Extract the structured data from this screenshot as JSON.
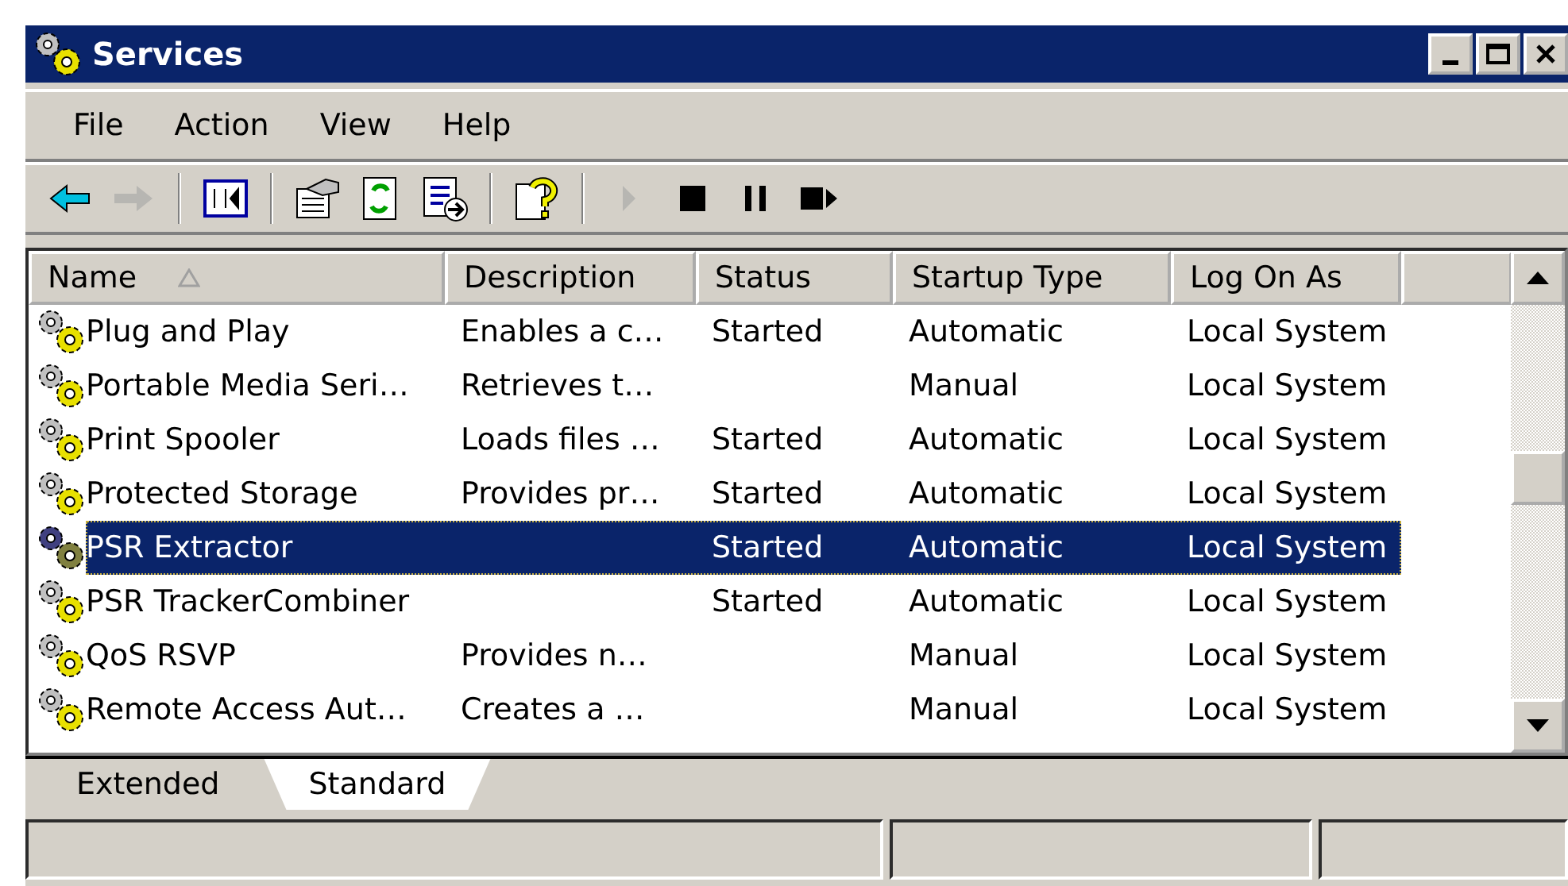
{
  "window": {
    "title": "Services"
  },
  "menu": [
    {
      "label": "File"
    },
    {
      "label": "Action"
    },
    {
      "label": "View"
    },
    {
      "label": "Help"
    }
  ],
  "toolbar": [
    {
      "kind": "back",
      "disabled": false
    },
    {
      "kind": "forward",
      "disabled": true
    },
    {
      "kind": "sep"
    },
    {
      "kind": "tree",
      "disabled": false
    },
    {
      "kind": "sep"
    },
    {
      "kind": "properties",
      "disabled": false
    },
    {
      "kind": "refresh",
      "disabled": false
    },
    {
      "kind": "export",
      "disabled": false
    },
    {
      "kind": "sep"
    },
    {
      "kind": "help",
      "disabled": false
    },
    {
      "kind": "sep"
    },
    {
      "kind": "start",
      "disabled": true
    },
    {
      "kind": "stop",
      "disabled": false
    },
    {
      "kind": "pause",
      "disabled": false
    },
    {
      "kind": "restart",
      "disabled": false
    }
  ],
  "table": {
    "columns": [
      "Name",
      "Description",
      "Status",
      "Startup Type",
      "Log On As"
    ],
    "rows": [
      {
        "name": "Plug and Play",
        "description": "Enables a c…",
        "status": "Started",
        "startup_type": "Automatic",
        "log_on_as": "Local System",
        "selected": false
      },
      {
        "name": "Portable Media Seri…",
        "description": "Retrieves t…",
        "status": "",
        "startup_type": "Manual",
        "log_on_as": "Local System",
        "selected": false
      },
      {
        "name": "Print Spooler",
        "description": "Loads files …",
        "status": "Started",
        "startup_type": "Automatic",
        "log_on_as": "Local System",
        "selected": false
      },
      {
        "name": "Protected Storage",
        "description": "Provides pr…",
        "status": "Started",
        "startup_type": "Automatic",
        "log_on_as": "Local System",
        "selected": false
      },
      {
        "name": "PSR Extractor",
        "description": "",
        "status": "Started",
        "startup_type": "Automatic",
        "log_on_as": "Local System",
        "selected": true
      },
      {
        "name": "PSR TrackerCombiner",
        "description": "",
        "status": "Started",
        "startup_type": "Automatic",
        "log_on_as": "Local System",
        "selected": false
      },
      {
        "name": "QoS RSVP",
        "description": "Provides n…",
        "status": "",
        "startup_type": "Manual",
        "log_on_as": "Local System",
        "selected": false
      },
      {
        "name": "Remote Access Aut…",
        "description": "Creates a …",
        "status": "",
        "startup_type": "Manual",
        "log_on_as": "Local System",
        "selected": false
      }
    ]
  },
  "tabs": [
    {
      "label": "Extended",
      "selected": false
    },
    {
      "label": "Standard",
      "selected": true
    }
  ]
}
